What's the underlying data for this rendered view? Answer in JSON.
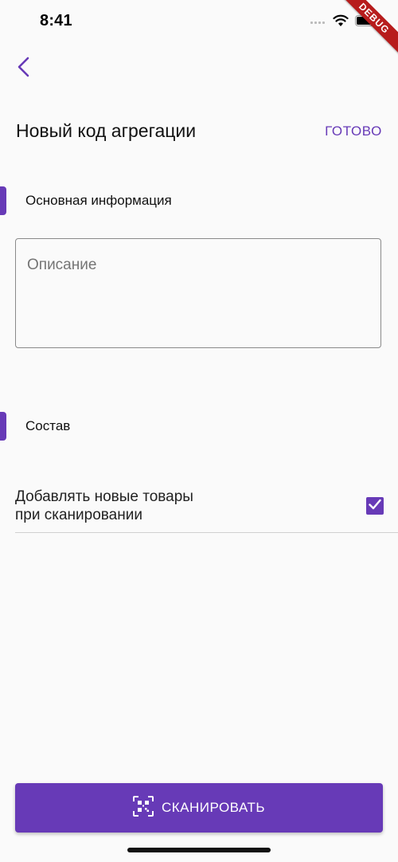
{
  "status_bar": {
    "time": "8:41",
    "icons": [
      "signal-icon",
      "wifi-icon",
      "battery-icon"
    ]
  },
  "debug_banner": "DEBUG",
  "header": {
    "back_icon": "chevron-left-icon",
    "title": "Новый код агрегации",
    "done_label": "ГОТОВО"
  },
  "sections": {
    "main_info": "Основная информация",
    "composition": "Состав"
  },
  "description_field": {
    "placeholder": "Описание",
    "value": ""
  },
  "add_new_items": {
    "label_line1": "Добавлять новые товары",
    "label_line2": "при сканировании",
    "checked": true
  },
  "scan_button": {
    "icon": "qr-code-scan-icon",
    "label": "СКАНИРОВАТЬ"
  },
  "colors": {
    "accent": "#673ab7",
    "background": "#fafafa",
    "debug_ribbon": "#b71c1c"
  }
}
